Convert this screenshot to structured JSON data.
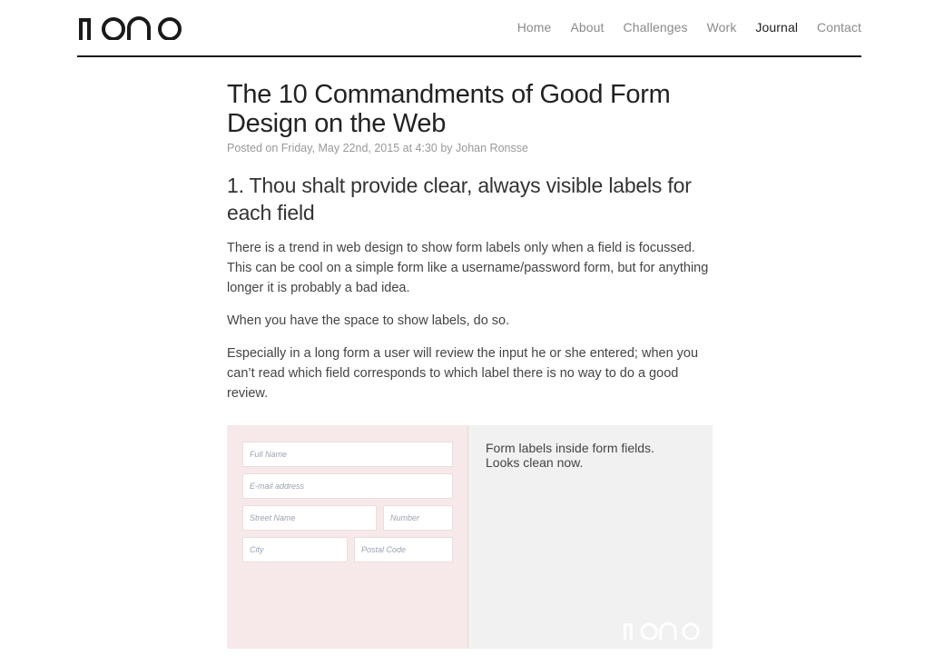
{
  "header": {
    "logo_text": "MONO",
    "nav": [
      {
        "label": "Home",
        "active": false
      },
      {
        "label": "About",
        "active": false
      },
      {
        "label": "Challenges",
        "active": false
      },
      {
        "label": "Work",
        "active": false
      },
      {
        "label": "Journal",
        "active": true
      },
      {
        "label": "Contact",
        "active": false
      }
    ]
  },
  "article": {
    "title": "The 10 Commandments of Good Form Design on the Web",
    "meta": "Posted on Friday, May 22nd, 2015 at 4:30 by Johan Ronsse",
    "section_heading": "1. Thou shalt provide clear, always visible labels for each field",
    "paragraphs": [
      "There is a trend in web design to show form labels only when a field is focussed. This can be cool on a simple form like a username/password form, but for anything longer it is probably a bad idea.",
      "When you have the space to show labels, do so.",
      "Especially in a long form a user will review the input he or she entered; when you can’t read which field corresponds to which label there is no way to do a good review."
    ]
  },
  "figure": {
    "fields": {
      "full_name": "Full Name",
      "email": "E-mail address",
      "street": "Street Name",
      "number": "Number",
      "city": "City",
      "postal": "Postal Code"
    },
    "caption_line1": "Form labels inside form fields.",
    "caption_line2": "Looks clean now.",
    "watermark": "MONO",
    "colors": {
      "left_bg": "#f7e9e9",
      "right_bg": "#f1f1f1"
    }
  }
}
